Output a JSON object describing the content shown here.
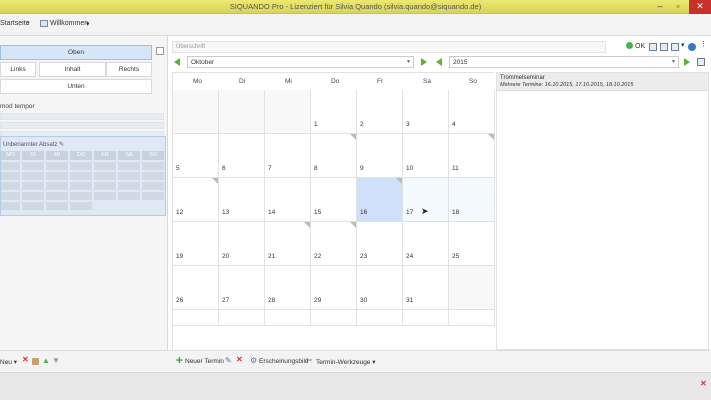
{
  "window": {
    "title": "SIQUANDO Pro - Lizenziert für Silvia Quando (silvia.quando@siquando.de)"
  },
  "navbar": {
    "crumb_start": "Startseite",
    "crumb_sep": "›",
    "tab_label": "Willkommen",
    "tab_caret": "▾"
  },
  "layout_buttons": {
    "top": "Oben",
    "left": "Links",
    "content": "Inhalt",
    "right": "Rechts",
    "bottom": "Unten"
  },
  "left": {
    "mod_label": "mod tempor",
    "cal_caption": "Unbenannter Absatz",
    "mini_days": [
      "MO",
      "DI",
      "MI",
      "DO",
      "FR",
      "SA",
      "SO"
    ]
  },
  "main": {
    "headline_placeholder": "Überschrift",
    "ok_label": "OK",
    "month": "Oktober",
    "year": "2015",
    "weekdays": [
      "Mo",
      "Di",
      "Mi",
      "Do",
      "Fr",
      "Sa",
      "So"
    ],
    "weeks": [
      [
        "",
        "",
        "",
        "1",
        "2",
        "3",
        "4"
      ],
      [
        "5",
        "6",
        "7",
        "8",
        "9",
        "10",
        "11"
      ],
      [
        "12",
        "13",
        "14",
        "15",
        "16",
        "17",
        "18"
      ],
      [
        "19",
        "20",
        "21",
        "22",
        "23",
        "24",
        "25"
      ],
      [
        "26",
        "27",
        "28",
        "29",
        "30",
        "31",
        ""
      ]
    ]
  },
  "detail": {
    "event_title": "Trommelseminar",
    "event_dates": "Mehrere Termine: 16.10.2015, 17.10.2015, 18.10.2015"
  },
  "bottom": {
    "new_label": "Neu",
    "new_caret": "▾",
    "new_appointment": "Neuer Termin",
    "appearance": "Erscheinungsbild",
    "tools": "Termin-Werkzeuge",
    "tools_caret": "▾"
  },
  "colors": {
    "accent_green": "#5bb33b",
    "today_blue": "#cfe0fa",
    "title_yellow": "#ece870"
  }
}
